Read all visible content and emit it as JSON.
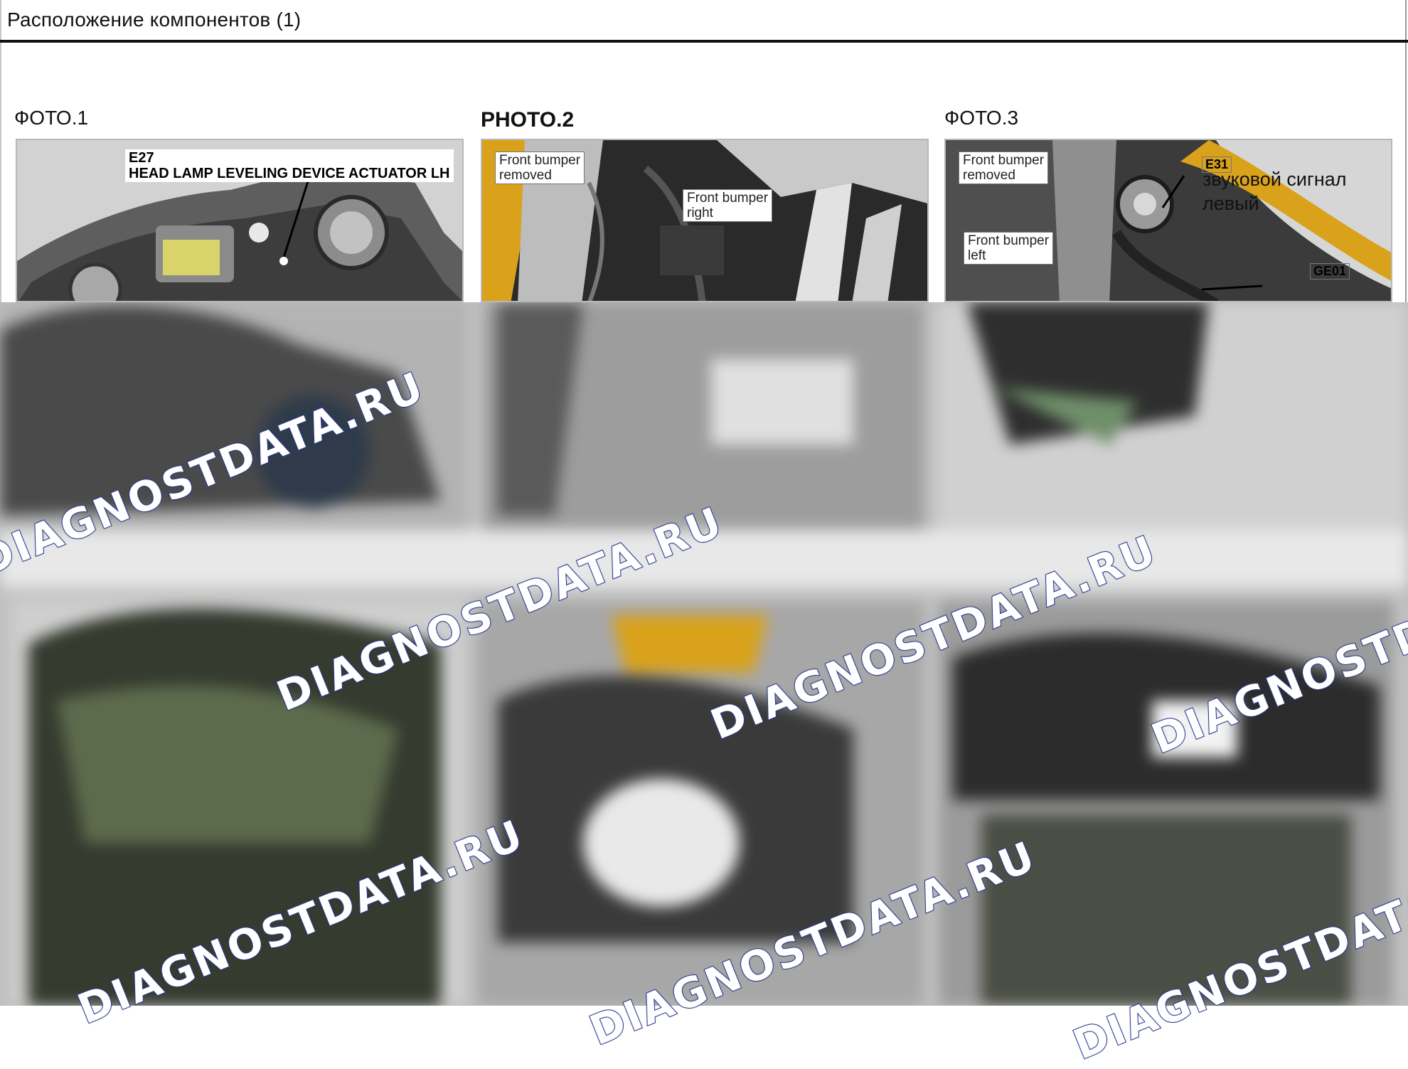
{
  "header": {
    "title": "Расположение компонентов (1)"
  },
  "photos": [
    {
      "label": "ФОТО.1",
      "callouts": [
        "E27\nHEAD LAMP LEVELING DEVICE ACTUATOR LH"
      ]
    },
    {
      "label": "PHOTO.2",
      "callouts": [
        "Front bumper\nremoved",
        "Front bumper\nright"
      ]
    },
    {
      "label": "ФОТО.3",
      "callouts": [
        "Front bumper\nremoved",
        "Front bumper\nleft",
        "E31",
        "звуковой сигнал\nлевый",
        "GE01"
      ]
    }
  ],
  "watermark": {
    "text": "DIAGNOSTDATA.RU",
    "color": "#2b3a8f"
  }
}
